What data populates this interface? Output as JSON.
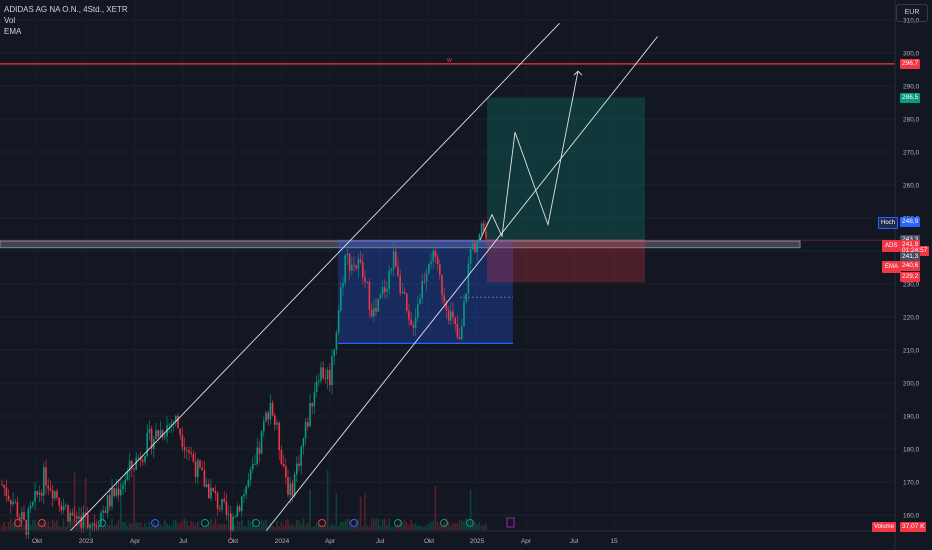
{
  "header": {
    "symbol_title": "ADIDAS AG NA O.N., 4Std., XETR",
    "indicators": [
      "Vol",
      "EMA"
    ]
  },
  "currency_button": "EUR",
  "chart_data": {
    "type": "candlestick",
    "title": "ADIDAS AG NA O.N., 4Std., XETR",
    "y_axis_ticks": [
      "310,0",
      "300,0",
      "290,0",
      "280,0",
      "270,0",
      "260,0",
      "250,0",
      "240,0",
      "230,0",
      "220,0",
      "210,0",
      "200,0",
      "190,0",
      "180,0",
      "170,0",
      "160,0"
    ],
    "x_axis_ticks": [
      "Okt",
      "2023",
      "Apr",
      "Jul",
      "Okt",
      "2024",
      "Apr",
      "Jul",
      "Okt",
      "2025",
      "Apr",
      "Jul",
      "15"
    ],
    "price_axis_labels": [
      {
        "text": "296,7",
        "value": 296.7,
        "color": "#f23645"
      },
      {
        "text": "286,5",
        "value": 286.5,
        "color": "#089981"
      },
      {
        "text": "248,9",
        "value": 248.9,
        "color": "#2962ff",
        "tag": "Hoch"
      },
      {
        "text": "243,3",
        "value": 243.3,
        "color": "#4a4e5a"
      },
      {
        "text": "241,9",
        "value": 241.9,
        "color": "#f23645",
        "tag": "ADS"
      },
      {
        "text": "01:24:57",
        "value": 239.9,
        "color": "#f23645"
      },
      {
        "text": "241,3",
        "value": 238.2,
        "color": "#4a4e5a"
      },
      {
        "text": "240,6",
        "value": 235.4,
        "color": "#f23645",
        "tag": "EMA"
      },
      {
        "text": "229,2",
        "value": 232.0,
        "color": "#f23645"
      }
    ],
    "volume_label": {
      "tag": "Volume",
      "text": "37,07 K"
    },
    "resistance_line": {
      "price": 296.7,
      "marker": "W",
      "color": "#f23645"
    },
    "support_zone": {
      "from": 241.0,
      "to": 243.0,
      "color": "#9598a1"
    },
    "range_box": {
      "top": 243.2,
      "bottom": 212.0,
      "color": "#2962ff"
    },
    "long_position": {
      "entry": 243.3,
      "target": 286.5,
      "stop": 230.5
    },
    "channel_lines": [
      {
        "from": [
          "2022-12",
          155.0
        ],
        "to": [
          "2025-06",
          309.0
        ]
      },
      {
        "from": [
          "2023-12",
          155.0
        ],
        "to": [
          "2025-12",
          305.0
        ]
      }
    ],
    "projected_path": [
      243.3,
      251.0,
      244.5,
      276.0,
      248.0,
      294.5
    ]
  }
}
